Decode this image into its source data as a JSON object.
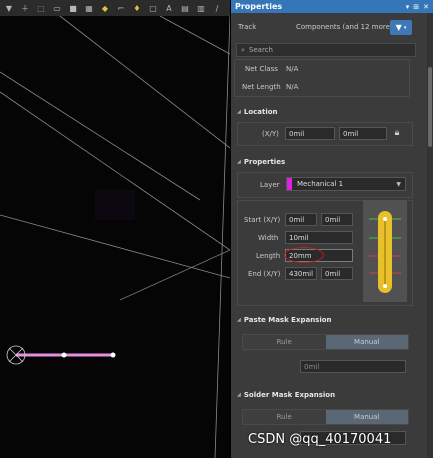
{
  "canvas": {
    "toolbar_icons": [
      "filter-icon",
      "plus-icon",
      "rect-select-icon",
      "square-icon",
      "component-icon",
      "chip-icon",
      "shape-icon",
      "route-icon",
      "pin-icon",
      "pad-icon",
      "text-icon",
      "grid-icon",
      "chart-icon",
      "arc-icon"
    ]
  },
  "panel": {
    "title": "Properties",
    "track_label": "Track",
    "components_text": "Components (and 12 more)",
    "search_placeholder": "Search",
    "net_class_label": "Net Class",
    "net_class_value": "N/A",
    "net_length_label": "Net Length",
    "net_length_value": "N/A",
    "location": {
      "header": "Location",
      "xy_label": "(X/Y)",
      "x": "0mil",
      "y": "0mil"
    },
    "properties": {
      "header": "Properties",
      "layer_label": "Layer",
      "layer_value": "Mechanical 1",
      "layer_color": "#e020e0",
      "start_label": "Start (X/Y)",
      "start_x": "0mil",
      "start_y": "0mil",
      "width_label": "Width",
      "width_value": "10mil",
      "length_label": "Length",
      "length_value": "20mm",
      "end_label": "End (X/Y)",
      "end_x": "430mil",
      "end_y": "0mil"
    },
    "paste_mask": {
      "header": "Paste Mask Expansion",
      "rule": "Rule",
      "manual": "Manual",
      "value": "0mil"
    },
    "solder_mask": {
      "header": "Solder Mask Expansion",
      "rule": "Rule",
      "manual": "Manual"
    }
  },
  "watermark": "CSDN @qq_40170041"
}
